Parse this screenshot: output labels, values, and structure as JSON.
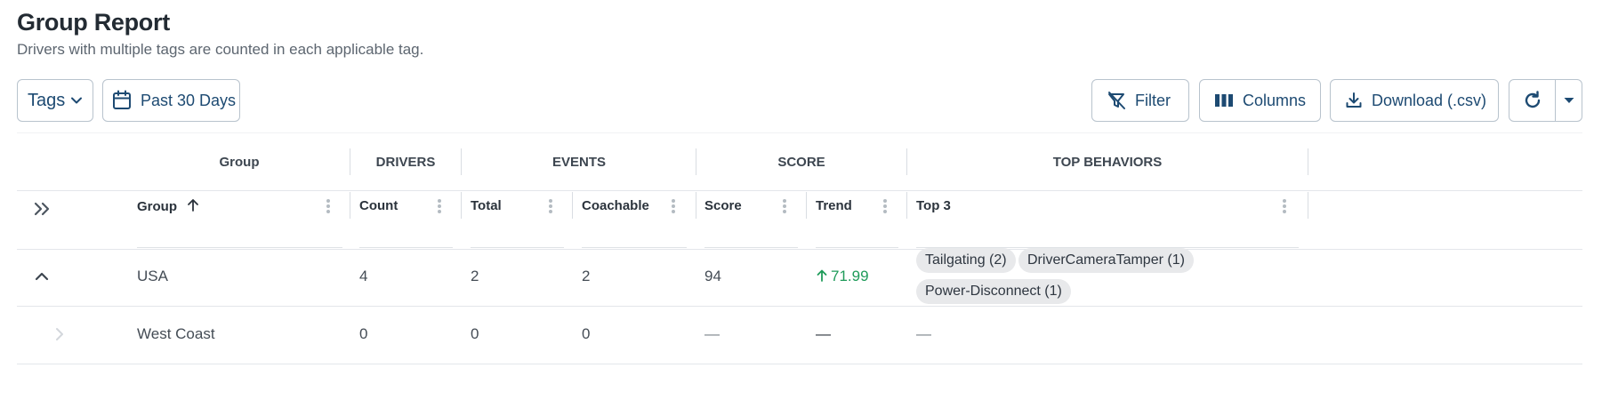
{
  "header": {
    "title": "Group Report",
    "subtitle": "Drivers with multiple tags are counted in each applicable tag."
  },
  "toolbar": {
    "tags_label": "Tags",
    "date_label": "Past 30 Days",
    "filter_label": "Filter",
    "columns_label": "Columns",
    "download_label": "Download (.csv)"
  },
  "table": {
    "group_headers": [
      "Group",
      "DRIVERS",
      "EVENTS",
      "SCORE",
      "TOP BEHAVIORS"
    ],
    "columns": [
      "Group",
      "Count",
      "Total",
      "Coachable",
      "Score",
      "Trend",
      "Top 3"
    ],
    "rows": [
      {
        "group": "USA",
        "count": "4",
        "total": "2",
        "coachable": "2",
        "score": "94",
        "trend": "71.99",
        "top3": [
          "Tailgating (2)",
          "DriverCameraTamper (1)",
          "Power-Disconnect (1)"
        ]
      },
      {
        "group": "West Coast",
        "count": "0",
        "total": "0",
        "coachable": "0",
        "score": "—",
        "trend": "—",
        "top3_empty": "—"
      }
    ]
  },
  "colors": {
    "accent": "#1d4a72",
    "trend_up": "#1f9b5a",
    "border": "#b8c3cd"
  },
  "icons": [
    "chevron-down-icon",
    "calendar-icon",
    "filter-off-icon",
    "columns-icon",
    "download-icon",
    "refresh-icon",
    "caret-down-icon",
    "expand-all-icon",
    "sort-up-icon",
    "kebab-icon",
    "collapse-icon",
    "trend-up-icon",
    "expand-icon"
  ]
}
